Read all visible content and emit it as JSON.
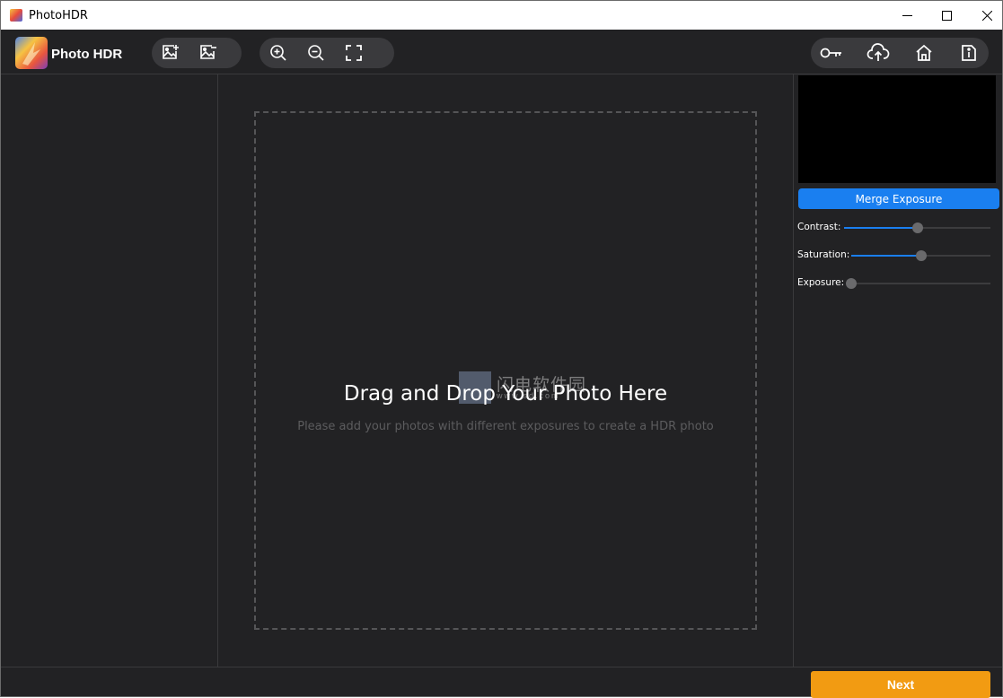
{
  "window": {
    "title": "PhotoHDR"
  },
  "toolbar": {
    "brand": "Photo HDR",
    "left_group": [
      {
        "icon": "add-image-icon"
      },
      {
        "icon": "remove-image-icon"
      }
    ],
    "zoom_group": [
      {
        "icon": "zoom-in-icon"
      },
      {
        "icon": "zoom-out-icon"
      },
      {
        "icon": "fullscreen-icon"
      }
    ],
    "right_group": [
      {
        "icon": "key-icon"
      },
      {
        "icon": "upload-cloud-icon"
      },
      {
        "icon": "home-icon"
      },
      {
        "icon": "info-icon"
      }
    ]
  },
  "canvas": {
    "drop_title": "Drag and Drop Your Photo Here",
    "drop_subtitle": "Please add your photos with different exposures to create a HDR photo",
    "watermark_text": "闪电软件园",
    "watermark_url": "www.sd.com"
  },
  "right_panel": {
    "merge_label": "Merge Exposure",
    "sliders": [
      {
        "label": "Contrast:",
        "value": 0.5
      },
      {
        "label": "Saturation:",
        "value": 0.5
      },
      {
        "label": "Exposure:",
        "value": 0.0
      }
    ]
  },
  "bottom": {
    "next_label": "Next"
  },
  "colors": {
    "background": "#222224",
    "accent_blue": "#1a7ff0",
    "next_orange": "#f29b12",
    "pill_bg": "#3a3a3d"
  }
}
